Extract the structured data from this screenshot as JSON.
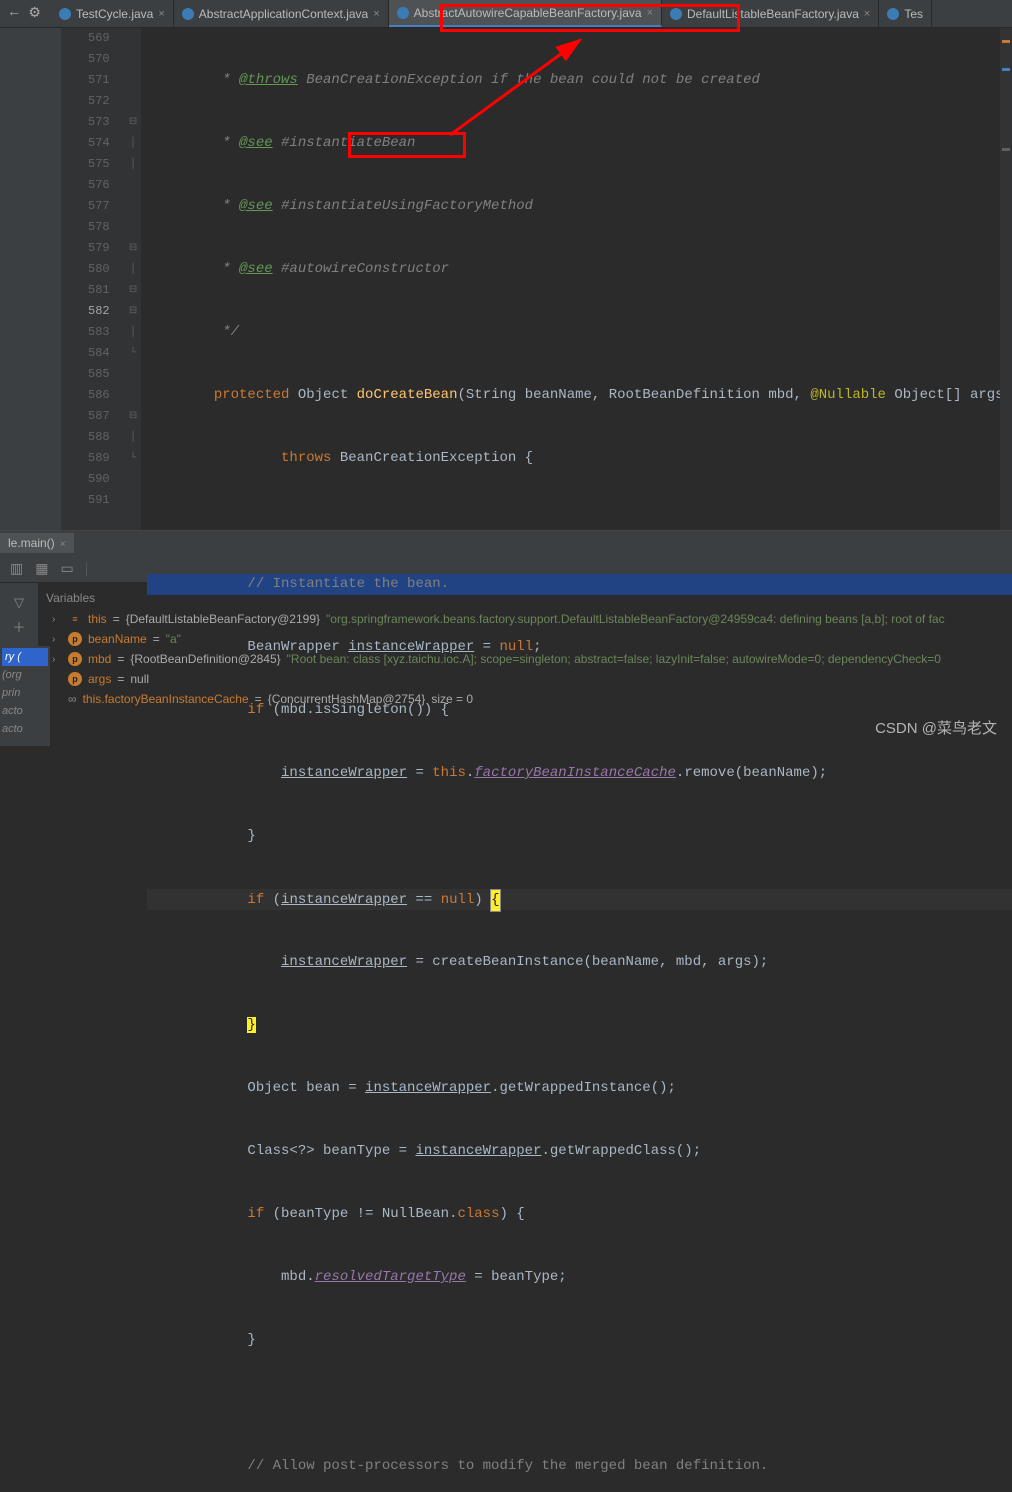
{
  "tabs": [
    {
      "label": "TestCycle.java"
    },
    {
      "label": "AbstractApplicationContext.java"
    },
    {
      "label": "AbstractAutowireCapableBeanFactory.java",
      "active": true
    },
    {
      "label": "DefaultListableBeanFactory.java"
    },
    {
      "label": "Tes"
    }
  ],
  "gutter": {
    "lines": [
      "569",
      "570",
      "571",
      "572",
      "573",
      "574",
      "575",
      "576",
      "577",
      "578",
      "579",
      "580",
      "581",
      "582",
      "583",
      "584",
      "585",
      "586",
      "587",
      "588",
      "589",
      "590",
      "591",
      ""
    ],
    "current": "582"
  },
  "code": {
    "l569": {
      "pre": "         * ",
      "tag": "@throws",
      "rest": " BeanCreationException if the bean could not be created"
    },
    "l570": {
      "pre": "         * ",
      "tag": "@see",
      "rest": " #instantiateBean"
    },
    "l571": {
      "pre": "         * ",
      "tag": "@see",
      "rest": " #instantiateUsingFactoryMethod"
    },
    "l572": {
      "pre": "         * ",
      "tag": "@see",
      "rest": " #autowireConstructor"
    },
    "l573": "         */",
    "l574": {
      "kw1": "protected",
      "t1": " Object ",
      "m": "doCreateBean",
      "t2": "(String beanName, RootBeanDefinition mbd, ",
      "ann": "@Nullable",
      "t3": " Object[] args)"
    },
    "l575": {
      "ind": "                ",
      "kw": "throws",
      "t": " BeanCreationException {"
    },
    "l576": "",
    "l577": {
      "ind": "            ",
      "c": "// Instantiate the bean."
    },
    "l578": {
      "ind": "            ",
      "t1": "BeanWrapper ",
      "v": "instanceWrapper",
      "t2": " = ",
      "kw": "null",
      "t3": ";"
    },
    "l579": {
      "ind": "            ",
      "kw": "if",
      "t1": " (mbd.isSingleton()) {"
    },
    "l580": {
      "ind": "                ",
      "v": "instanceWrapper",
      "t1": " = ",
      "kw": "this",
      "t2": ".",
      "f": "factoryBeanInstanceCache",
      "t3": ".remove(beanName);"
    },
    "l581": {
      "ind": "            ",
      "t": "}"
    },
    "l582": {
      "ind": "            ",
      "kw": "if",
      "t1": " (",
      "v": "instanceWrapper",
      "t2": " == ",
      "kw2": "null",
      "t3": ") ",
      "b": "{"
    },
    "l583": {
      "ind": "                ",
      "v": "instanceWrapper",
      "t1": " = createBeanInstance(beanName, mbd, args);"
    },
    "l584": {
      "ind": "            ",
      "b": "}"
    },
    "l585": {
      "ind": "            ",
      "t1": "Object bean = ",
      "v": "instanceWrapper",
      "t2": ".getWrappedInstance();"
    },
    "l586": {
      "ind": "            ",
      "t1": "Class<?> beanType = ",
      "v": "instanceWrapper",
      "t2": ".getWrappedClass();"
    },
    "l587": {
      "ind": "            ",
      "kw": "if",
      "t1": " (beanType != NullBean.",
      "kw2": "class",
      "t2": ") {"
    },
    "l588": {
      "ind": "                ",
      "t1": "mbd.",
      "f": "resolvedTargetType",
      "t2": " = beanType;"
    },
    "l589": {
      "ind": "            ",
      "t": "}"
    },
    "l590": "",
    "l591": {
      "ind": "            ",
      "c": "// Allow post-processors to modify the merged bean definition."
    }
  },
  "debug": {
    "tab": "le.main()",
    "vars_title": "Variables",
    "rows": [
      {
        "icon": "≡",
        "chev": "›",
        "name": "this",
        "eq": " = ",
        "meta": "{DefaultListableBeanFactory@2199}",
        "str": " \"org.springframework.beans.factory.support.DefaultListableBeanFactory@24959ca4: defining beans [a,b]; root of fac"
      },
      {
        "icon": "p",
        "chev": "›",
        "name": "beanName",
        "eq": " = ",
        "str": "\"a\""
      },
      {
        "icon": "p",
        "chev": "›",
        "name": "mbd",
        "eq": " = ",
        "meta": "{RootBeanDefinition@2845}",
        "str": " \"Root bean: class [xyz.taichu.ioc.A]; scope=singleton; abstract=false; lazyInit=false; autowireMode=0; dependencyCheck=0"
      },
      {
        "icon": "p",
        "chev": "",
        "name": "args",
        "eq": " = ",
        "val": "null"
      },
      {
        "icon": "∞",
        "chev": "",
        "name": "this.factoryBeanInstanceCache",
        "eq": " = ",
        "meta": "{ConcurrentHashMap@2754}",
        "val": "  size = 0"
      }
    ]
  },
  "watermark": "CSDN @菜鸟老文",
  "frames_label": "ry (",
  "frames_sub": [
    "(org",
    "prin",
    "acto",
    "acto"
  ]
}
